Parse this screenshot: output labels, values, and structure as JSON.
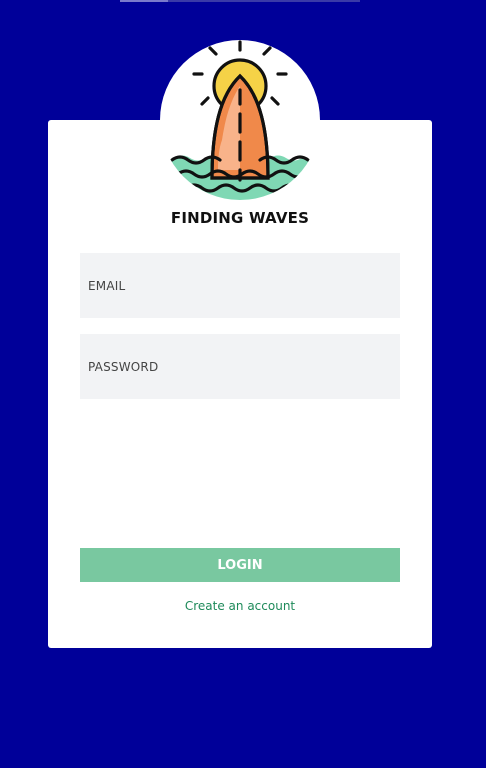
{
  "brand": {
    "title": "FINDING WAVES",
    "logo_icon": "sunset-surfboard-waves-icon"
  },
  "form": {
    "email_placeholder": "EMAIL",
    "password_placeholder": "PASSWORD",
    "login_label": "LOGIN",
    "create_account_label": "Create an account"
  },
  "colors": {
    "background": "#000099",
    "card": "#ffffff",
    "input_bg": "#f2f3f5",
    "button": "#79c8a0",
    "link": "#1e8a5a",
    "sun": "#f5d247",
    "surfboard": "#f0894a",
    "water": "#7fd8b4"
  }
}
